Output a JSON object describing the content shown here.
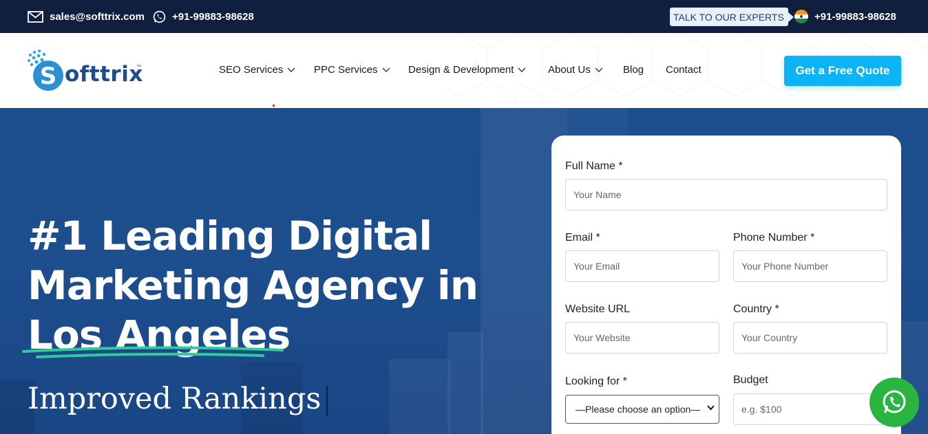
{
  "topbar": {
    "email": "sales@softtrix.com",
    "phone_left": "+91-99883-98628",
    "talk_label": "TALK TO OUR EXPERTS",
    "phone_right": "+91-99883-98628"
  },
  "header": {
    "logo_text": "Softtrix",
    "nav": [
      {
        "label": "SEO Services"
      },
      {
        "label": "PPC Services"
      },
      {
        "label": "Design & Development"
      },
      {
        "label": "About Us"
      },
      {
        "label": "Blog"
      },
      {
        "label": "Contact"
      }
    ],
    "cta": "Get a Free Quote"
  },
  "hero": {
    "title_line1": "#1 Leading Digital",
    "title_line2": "Marketing Agency in",
    "title_line3": "Los Angeles",
    "subtitle": "Improved Rankings"
  },
  "form": {
    "full_name_label": "Full Name *",
    "full_name_placeholder": "Your Name",
    "email_label": "Email *",
    "email_placeholder": "Your Email",
    "phone_label": "Phone Number *",
    "phone_placeholder": "Your Phone Number",
    "website_label": "Website URL",
    "website_placeholder": "Your Website",
    "country_label": "Country *",
    "country_placeholder": "Your Country",
    "looking_label": "Looking for *",
    "looking_value": "—Please choose an option—",
    "budget_label": "Budget",
    "budget_placeholder": "e.g. $100"
  },
  "colors": {
    "topbar_bg": "#0f1f3d",
    "hero_bg": "#1b4d8f",
    "cta_bg": "#0bb4f4",
    "accent_underline": "#2ecc9a",
    "whatsapp_green": "#2ab540"
  }
}
